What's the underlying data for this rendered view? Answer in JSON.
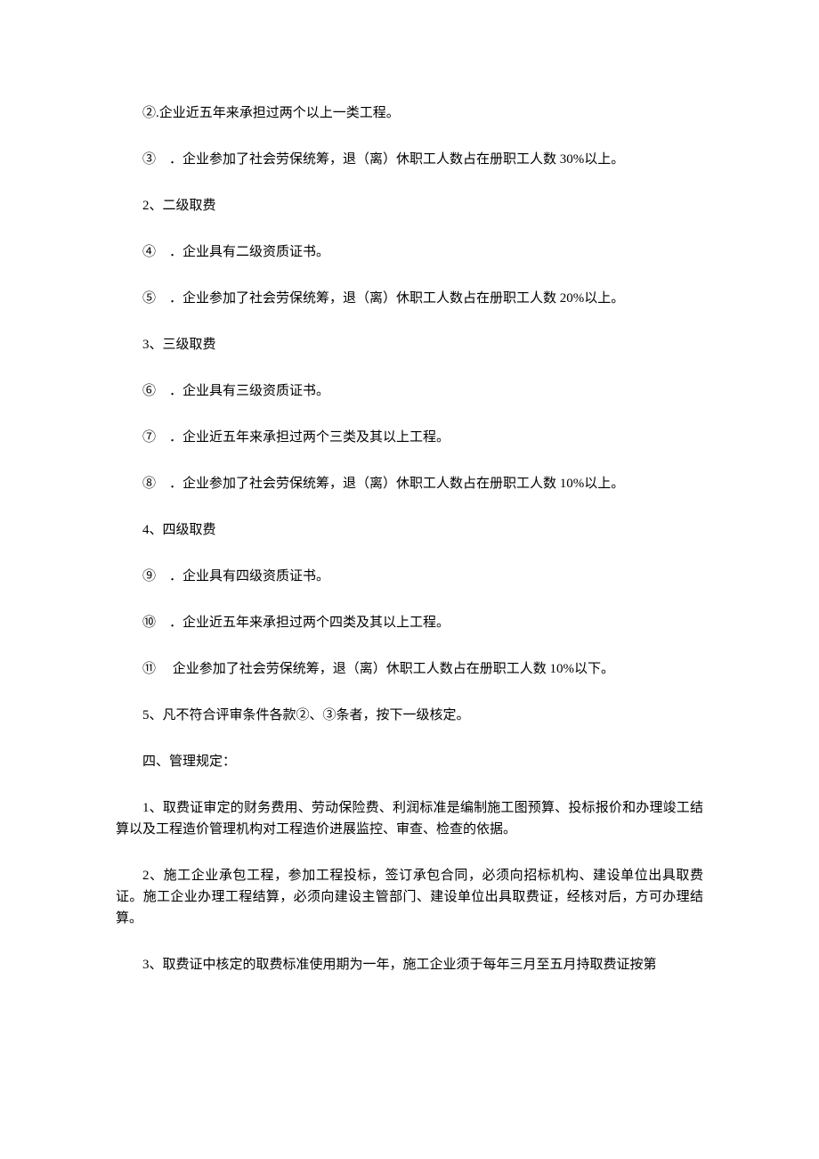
{
  "lines": [
    "②.企业近五年来承担过两个以上一类工程。",
    "③　．企业参加了社会劳保统筹，退（离）休职工人数占在册职工人数 30%以上。",
    "2、二级取费",
    "④　．企业具有二级资质证书。",
    "⑤　．企业参加了社会劳保统筹，退（离）休职工人数占在册职工人数 20%以上。",
    "3、三级取费",
    "⑥　．企业具有三级资质证书。",
    "⑦　．企业近五年来承担过两个三类及其以上工程。",
    "⑧　．企业参加了社会劳保统筹，退（离）休职工人数占在册职工人数 10%以上。",
    "4、四级取费",
    "⑨　．企业具有四级资质证书。",
    "⑩　．企业近五年来承担过两个四类及其以上工程。",
    "⑪　 企业参加了社会劳保统筹，退（离）休职工人数占在册职工人数 10%以下。",
    "5、凡不符合评审条件各款②、③条者，按下一级核定。",
    "四、管理规定：",
    "1、取费证审定的财务费用、劳动保险费、利润标准是编制施工图预算、投标报价和办理竣工结算以及工程造价管理机构对工程造价进展监控、审查、检查的依据。",
    "2、施工企业承包工程，参加工程投标，签订承包合同，必须向招标机构、建设单位出具取费证。施工企业办理工程结算，必须向建设主管部门、建设单位出具取费证，经核对后，方可办理结算。",
    "3、取费证中核定的取费标准使用期为一年，施工企业须于每年三月至五月持取费证按第"
  ]
}
